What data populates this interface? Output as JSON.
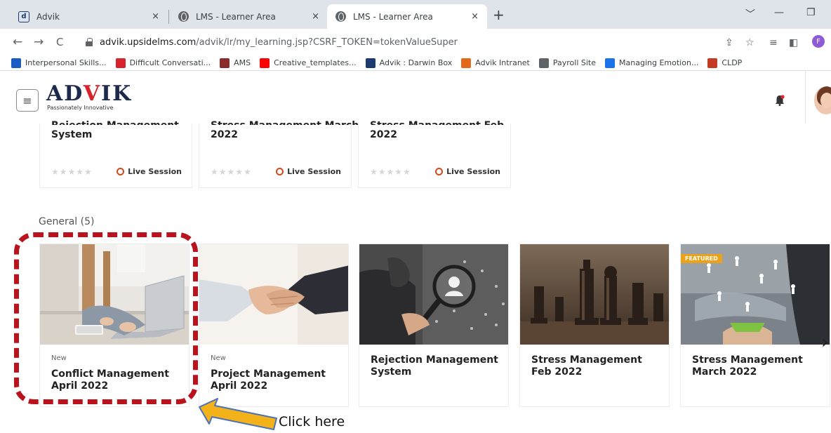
{
  "browser": {
    "tabs": [
      {
        "label": "Advik",
        "close": "×"
      },
      {
        "label": "LMS - Learner Area",
        "close": "×"
      },
      {
        "label": "LMS - Learner Area",
        "close": "×"
      }
    ],
    "new_tab": "+",
    "window_controls": [
      "﹀",
      "—",
      "❐"
    ],
    "nav": {
      "back": "←",
      "forward": "→",
      "reload": "C"
    },
    "url_host": "advik.upsidelms.com",
    "url_path": "/advik/lr/my_learning.jsp?CSRF_TOKEN=tokenValueSuper",
    "toolbar_icons": [
      "⇪",
      "☆",
      "≡",
      "◧"
    ],
    "profile_initial": "F",
    "bookmarks": [
      {
        "label": "Interpersonal Skills...",
        "color": "#1a5bc4"
      },
      {
        "label": "Difficult Conversati...",
        "color": "#d7232c"
      },
      {
        "label": "AMS",
        "color": "#8a2b2b"
      },
      {
        "label": "Creative_templates...",
        "color": "#ff0000"
      },
      {
        "label": "Advik : Darwin Box",
        "color": "#1a3a70"
      },
      {
        "label": "Advik Intranet",
        "color": "#e36a1a"
      },
      {
        "label": "Payroll Site",
        "color": "#5f6368"
      },
      {
        "label": "Managing Emotion...",
        "color": "#1a73e8"
      },
      {
        "label": "CLDP",
        "color": "#c23b22"
      }
    ]
  },
  "header": {
    "menu_icon": "≡",
    "logo_left": "AD",
    "logo_v": "V",
    "logo_right": "IK",
    "tagline": "Passionately Innovative"
  },
  "top_cards": [
    {
      "title_cut": "Rejection Management",
      "title_line2": "System",
      "stars": "★★★★★",
      "live": "Live Session"
    },
    {
      "title_cut": "Stress Management March",
      "title_line2": "2022",
      "stars": "★★★★★",
      "live": "Live Session"
    },
    {
      "title_cut": "Stress Management Feb",
      "title_line2": "2022",
      "stars": "★★★★★",
      "live": "Live Session"
    }
  ],
  "section": {
    "title": "General (5)"
  },
  "courses": [
    {
      "badge": "New",
      "title": "Conflict Management April 2022"
    },
    {
      "badge": "New",
      "title": "Project Management April 2022"
    },
    {
      "badge": "",
      "title": "Rejection Management System"
    },
    {
      "badge": "",
      "title": "Stress Management Feb 2022"
    },
    {
      "badge": "",
      "title": "Stress Management March 2022",
      "featured": "FEATURED"
    }
  ],
  "next_arrow": "›",
  "annotation": {
    "label": "Click here"
  }
}
